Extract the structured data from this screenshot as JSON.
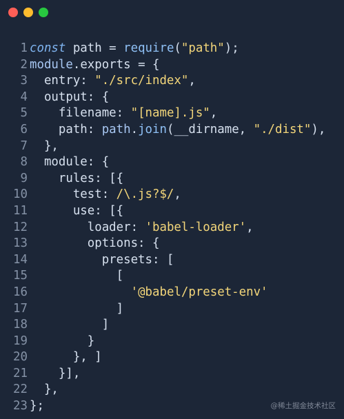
{
  "window": {
    "controls": {
      "close_color": "#ff5f57",
      "minimize_color": "#febc2e",
      "maximize_color": "#28c840"
    }
  },
  "code": {
    "lines": [
      {
        "num": "1",
        "tokens": [
          {
            "t": "const",
            "c": "kw"
          },
          {
            "t": " path = ",
            "c": "var"
          },
          {
            "t": "require",
            "c": "fn"
          },
          {
            "t": "(",
            "c": "punc"
          },
          {
            "t": "\"path\"",
            "c": "str"
          },
          {
            "t": ");",
            "c": "punc"
          }
        ]
      },
      {
        "num": "2",
        "tokens": [
          {
            "t": "module",
            "c": "obj"
          },
          {
            "t": ".",
            "c": "punc"
          },
          {
            "t": "exports",
            "c": "prop"
          },
          {
            "t": " = {",
            "c": "punc"
          }
        ]
      },
      {
        "num": "3",
        "tokens": [
          {
            "t": "  entry: ",
            "c": "prop"
          },
          {
            "t": "\"./src/index\"",
            "c": "str"
          },
          {
            "t": ",",
            "c": "punc"
          }
        ]
      },
      {
        "num": "4",
        "tokens": [
          {
            "t": "  output: {",
            "c": "prop"
          }
        ]
      },
      {
        "num": "5",
        "tokens": [
          {
            "t": "    filename: ",
            "c": "prop"
          },
          {
            "t": "\"[name].js\"",
            "c": "str"
          },
          {
            "t": ",",
            "c": "punc"
          }
        ]
      },
      {
        "num": "6",
        "tokens": [
          {
            "t": "    path: ",
            "c": "prop"
          },
          {
            "t": "path",
            "c": "obj"
          },
          {
            "t": ".",
            "c": "punc"
          },
          {
            "t": "join",
            "c": "fn"
          },
          {
            "t": "(__dirname, ",
            "c": "var"
          },
          {
            "t": "\"./dist\"",
            "c": "str"
          },
          {
            "t": "),",
            "c": "punc"
          }
        ]
      },
      {
        "num": "7",
        "tokens": [
          {
            "t": "  },",
            "c": "punc"
          }
        ]
      },
      {
        "num": "8",
        "tokens": [
          {
            "t": "  module: {",
            "c": "prop"
          }
        ]
      },
      {
        "num": "9",
        "tokens": [
          {
            "t": "    rules: [{",
            "c": "prop"
          }
        ]
      },
      {
        "num": "10",
        "tokens": [
          {
            "t": "      test: ",
            "c": "prop"
          },
          {
            "t": "/\\.js?$/",
            "c": "regex"
          },
          {
            "t": ",",
            "c": "punc"
          }
        ]
      },
      {
        "num": "11",
        "tokens": [
          {
            "t": "      use: [{",
            "c": "prop"
          }
        ]
      },
      {
        "num": "12",
        "tokens": [
          {
            "t": "        loader: ",
            "c": "prop"
          },
          {
            "t": "'babel-loader'",
            "c": "str"
          },
          {
            "t": ",",
            "c": "punc"
          }
        ]
      },
      {
        "num": "13",
        "tokens": [
          {
            "t": "        options: {",
            "c": "prop"
          }
        ]
      },
      {
        "num": "14",
        "tokens": [
          {
            "t": "          presets: [",
            "c": "prop"
          }
        ]
      },
      {
        "num": "15",
        "tokens": [
          {
            "t": "            [",
            "c": "punc"
          }
        ]
      },
      {
        "num": "16",
        "tokens": [
          {
            "t": "              ",
            "c": "punc"
          },
          {
            "t": "'@babel/preset-env'",
            "c": "str"
          }
        ]
      },
      {
        "num": "17",
        "tokens": [
          {
            "t": "            ]",
            "c": "punc"
          }
        ]
      },
      {
        "num": "18",
        "tokens": [
          {
            "t": "          ]",
            "c": "punc"
          }
        ]
      },
      {
        "num": "19",
        "tokens": [
          {
            "t": "        }",
            "c": "punc"
          }
        ]
      },
      {
        "num": "20",
        "tokens": [
          {
            "t": "      }, ]",
            "c": "punc"
          }
        ]
      },
      {
        "num": "21",
        "tokens": [
          {
            "t": "    }],",
            "c": "punc"
          }
        ]
      },
      {
        "num": "22",
        "tokens": [
          {
            "t": "  },",
            "c": "punc"
          }
        ]
      },
      {
        "num": "23",
        "tokens": [
          {
            "t": "};",
            "c": "punc"
          }
        ]
      }
    ]
  },
  "watermark": {
    "text": "@稀土掘金技术社区"
  }
}
